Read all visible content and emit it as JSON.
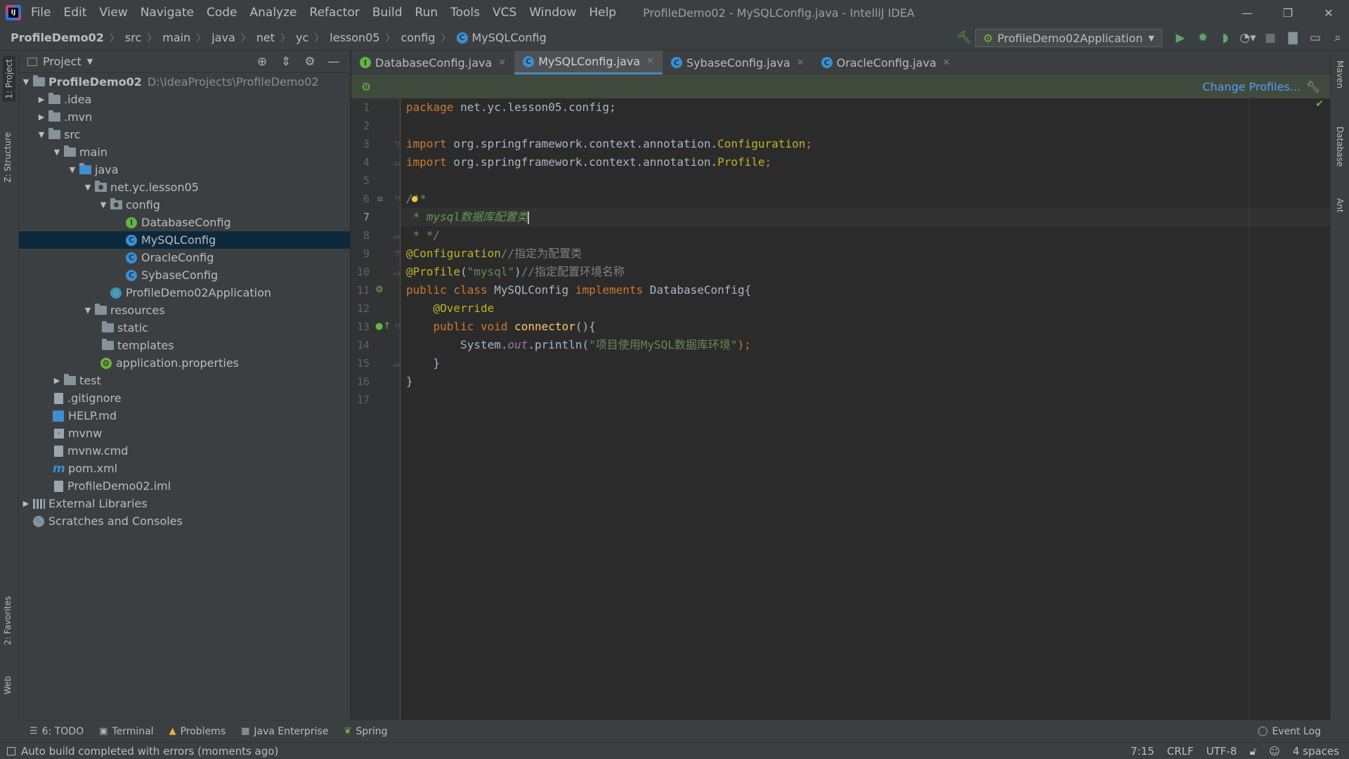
{
  "menu": {
    "items": [
      "File",
      "Edit",
      "View",
      "Navigate",
      "Code",
      "Analyze",
      "Refactor",
      "Build",
      "Run",
      "Tools",
      "VCS",
      "Window",
      "Help"
    ],
    "window_title": "ProfileDemo02 - MySQLConfig.java - IntelliJ IDEA"
  },
  "window_controls": {
    "minimize": "—",
    "restore": "❐",
    "close": "✕"
  },
  "breadcrumb": [
    "ProfileDemo02",
    "src",
    "main",
    "java",
    "net",
    "yc",
    "lesson05",
    "config",
    "MySQLConfig"
  ],
  "toolbar": {
    "run_config": "ProfileDemo02Application",
    "icons": [
      "hammer-icon",
      "run-icon",
      "debug-icon",
      "coverage-icon",
      "profile-icon",
      "stop-icon",
      "project-structure-icon",
      "layout-icon",
      "search-icon"
    ]
  },
  "left_stripe": {
    "project": "1: Project",
    "structure": "Z: Structure",
    "favorites": "2: Favorites",
    "web": "Web"
  },
  "right_stripe": {
    "maven": "Maven",
    "database": "Database",
    "ant": "Ant"
  },
  "project_panel": {
    "title": "Project",
    "tree": [
      {
        "label": "ProfileDemo02",
        "path": "D:\\IdeaProjects\\ProfileDemo02"
      },
      {
        "label": ".idea"
      },
      {
        "label": ".mvn"
      },
      {
        "label": "src"
      },
      {
        "label": "main"
      },
      {
        "label": "java"
      },
      {
        "label": "net.yc.lesson05"
      },
      {
        "label": "config"
      },
      {
        "label": "DatabaseConfig"
      },
      {
        "label": "MySQLConfig"
      },
      {
        "label": "OracleConfig"
      },
      {
        "label": "SybaseConfig"
      },
      {
        "label": "ProfileDemo02Application"
      },
      {
        "label": "resources"
      },
      {
        "label": "static"
      },
      {
        "label": "templates"
      },
      {
        "label": "application.properties"
      },
      {
        "label": "test"
      },
      {
        "label": ".gitignore"
      },
      {
        "label": "HELP.md"
      },
      {
        "label": "mvnw"
      },
      {
        "label": "mvnw.cmd"
      },
      {
        "label": "pom.xml"
      },
      {
        "label": "ProfileDemo02.iml"
      },
      {
        "label": "External Libraries"
      },
      {
        "label": "Scratches and Consoles"
      }
    ]
  },
  "tabs": [
    {
      "label": "DatabaseConfig.java",
      "icon": "I"
    },
    {
      "label": "MySQLConfig.java",
      "icon": "C"
    },
    {
      "label": "SybaseConfig.java",
      "icon": "C"
    },
    {
      "label": "OracleConfig.java",
      "icon": "C"
    }
  ],
  "profiles_bar": {
    "link": "Change Profiles..."
  },
  "editor": {
    "line_numbers": [
      "1",
      "2",
      "3",
      "4",
      "5",
      "6",
      "7",
      "8",
      "9",
      "10",
      "11",
      "12",
      "13",
      "14",
      "15",
      "16",
      "17"
    ],
    "lines": {
      "l1_kw": "package",
      "l1_rest": " net.yc.lesson05.config;",
      "l3_kw": "import",
      "l3_pkg": " org.springframework.context.annotation.",
      "l3_cls": "Configuration",
      "l4_kw": "import",
      "l4_pkg": " org.springframework.context.annotation.",
      "l4_cls": "Profile",
      "l6": "/**",
      "l7": " * mysql数据库配置类",
      "l8": " * */",
      "l9_ann": "@Configuration",
      "l9_cmt": "//指定为配置类",
      "l10_ann": "@Profile",
      "l10_str": "\"mysql\"",
      "l10_cmt": "//指定配置环境名称",
      "l11_kw1": "public class",
      "l11_name": " MySQLConfig ",
      "l11_kw2": "implements",
      "l11_rest": " DatabaseConfig{",
      "l12_ann": "@Override",
      "l13_kw": "public void",
      "l13_fn": "connector",
      "l13_rest": "(){",
      "l14_sys": "System.",
      "l14_out": "out",
      "l14_call": ".println(",
      "l14_str": "\"项目使用MySQL数据库环境\"",
      "l14_end": ");",
      "l15": "}",
      "l16": "}"
    }
  },
  "bottom_tools": [
    "6: TODO",
    "Terminal",
    "Problems",
    "Java Enterprise",
    "Spring"
  ],
  "event_log": "Event Log",
  "status": {
    "message": "Auto build completed with errors (moments ago)",
    "position": "7:15",
    "line_sep": "CRLF",
    "encoding": "UTF-8",
    "indent": "4 spaces"
  }
}
